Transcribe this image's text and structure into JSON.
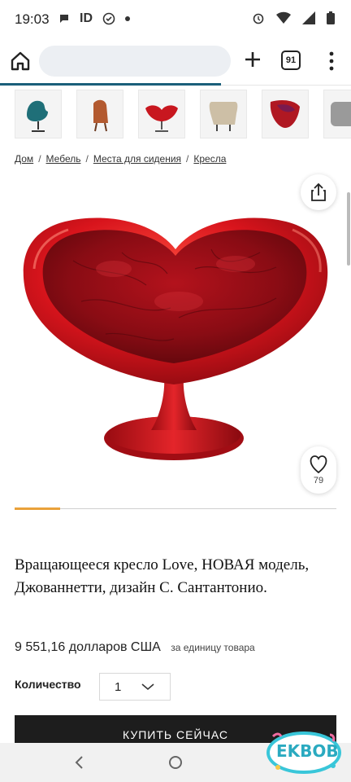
{
  "status_bar": {
    "time": "19:03",
    "id_label": "ID",
    "icons": [
      "message-icon",
      "id-icon",
      "check-circle-icon",
      "dot-icon",
      "alarm-icon",
      "wifi-icon",
      "signal-icon",
      "battery-icon"
    ]
  },
  "browser": {
    "tab_count": "91",
    "icons": [
      "home-icon",
      "plus-icon",
      "tabs-icon",
      "menu-icon"
    ]
  },
  "thumbnails": [
    {
      "name": "thumb-teal-swan-chair",
      "color": "#1f6f78"
    },
    {
      "name": "thumb-brown-chair",
      "color": "#b35a30"
    },
    {
      "name": "thumb-red-swivel-chair",
      "color": "#c8171f"
    },
    {
      "name": "thumb-beige-chair",
      "color": "#cdbfa6"
    },
    {
      "name": "thumb-red-shell-chair",
      "color": "#b01822"
    },
    {
      "name": "thumb-grey-chair",
      "color": "#9a9a9a"
    }
  ],
  "breadcrumb": [
    "Дом",
    "Мебель",
    "Места для сидения",
    "Кресла"
  ],
  "product": {
    "title": "Вращающееся кресло Love, НОВАЯ модель, Джованнетти, дизайн С. Сантантонио.",
    "price": "9 551,16 долларов США",
    "per_unit": "за единицу товара",
    "quantity_label": "Количество",
    "quantity_value": "1",
    "buy_label": "КУПИТЬ СЕЙЧАС",
    "favorites_count": "79",
    "image_color": "#c4121c"
  },
  "watermark": "EKBOB"
}
